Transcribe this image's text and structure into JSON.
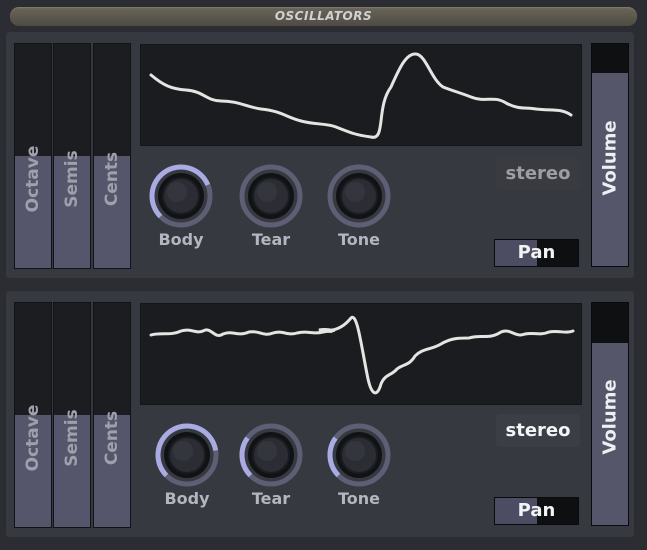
{
  "header": {
    "title": "OSCILLATORS"
  },
  "oscillators": [
    {
      "tuning": [
        {
          "label": "Octave",
          "value": 0.5
        },
        {
          "label": "Semis",
          "value": 0.5
        },
        {
          "label": "Cents",
          "value": 0.5
        }
      ],
      "knobs": [
        {
          "label": "Body",
          "value": 0.75
        },
        {
          "label": "Tear",
          "value": 0.0
        },
        {
          "label": "Tone",
          "value": 0.0
        }
      ],
      "stereo": {
        "label": "stereo",
        "active": false
      },
      "pan": {
        "label": "Pan",
        "value": 0.5
      },
      "volume": {
        "label": "Volume",
        "value": 0.87
      }
    },
    {
      "tuning": [
        {
          "label": "Octave",
          "value": 0.5
        },
        {
          "label": "Semis",
          "value": 0.5
        },
        {
          "label": "Cents",
          "value": 0.5
        }
      ],
      "knobs": [
        {
          "label": "Body",
          "value": 0.8
        },
        {
          "label": "Tear",
          "value": 0.3
        },
        {
          "label": "Tone",
          "value": 0.3
        }
      ],
      "stereo": {
        "label": "stereo",
        "active": true
      },
      "pan": {
        "label": "Pan",
        "value": 0.5
      },
      "volume": {
        "label": "Volume",
        "value": 0.82
      }
    }
  ],
  "colors": {
    "accent": "#a9abe2",
    "knob_track": "#5e5f75",
    "waveform": "#e4e4e2",
    "stereo_active_text": "#f4f5f7",
    "stereo_inactive_text": "#9c9da5",
    "stereo_active_bg": "#3c3e45",
    "stereo_inactive_bg": "#393b41"
  }
}
